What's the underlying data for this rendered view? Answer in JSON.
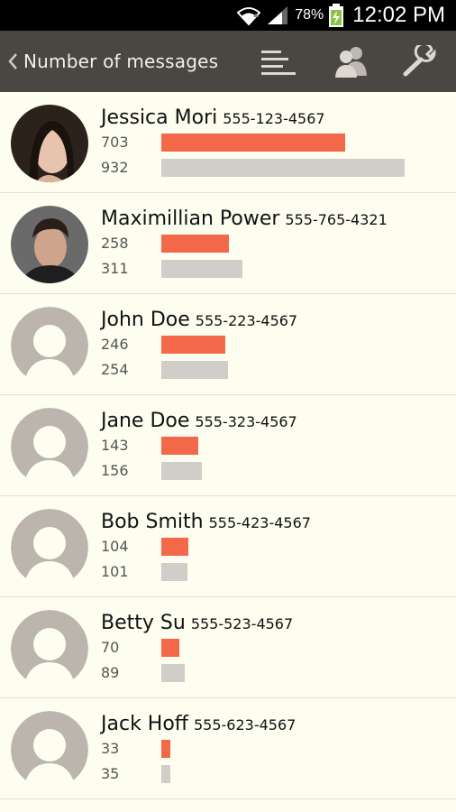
{
  "status_bar": {
    "battery_percent": "78%",
    "clock": "12:02 PM"
  },
  "action_bar": {
    "title": "Number of messages",
    "icons": [
      "back-chevron",
      "sort-bars-icon",
      "contacts-icon",
      "wrench-icon"
    ]
  },
  "colors": {
    "action_bar_bg": "#4a4641",
    "page_bg": "#fdfdf0",
    "sent_bar": "#f4684a",
    "received_bar": "#d1cdc8",
    "avatar_placeholder": "#bcb5ae"
  },
  "contacts": [
    {
      "name": "Jessica Mori",
      "phone": "555-123-4567",
      "sent": 703,
      "received": 932,
      "avatar": "photo"
    },
    {
      "name": "Maximillian Power",
      "phone": "555-765-4321",
      "sent": 258,
      "received": 311,
      "avatar": "photo"
    },
    {
      "name": "John Doe",
      "phone": "555-223-4567",
      "sent": 246,
      "received": 254,
      "avatar": "placeholder"
    },
    {
      "name": "Jane Doe",
      "phone": "555-323-4567",
      "sent": 143,
      "received": 156,
      "avatar": "placeholder"
    },
    {
      "name": "Bob Smith",
      "phone": "555-423-4567",
      "sent": 104,
      "received": 101,
      "avatar": "placeholder"
    },
    {
      "name": "Betty Su",
      "phone": "555-523-4567",
      "sent": 70,
      "received": 89,
      "avatar": "placeholder"
    },
    {
      "name": "Jack Hoff",
      "phone": "555-623-4567",
      "sent": 33,
      "received": 35,
      "avatar": "placeholder"
    }
  ]
}
